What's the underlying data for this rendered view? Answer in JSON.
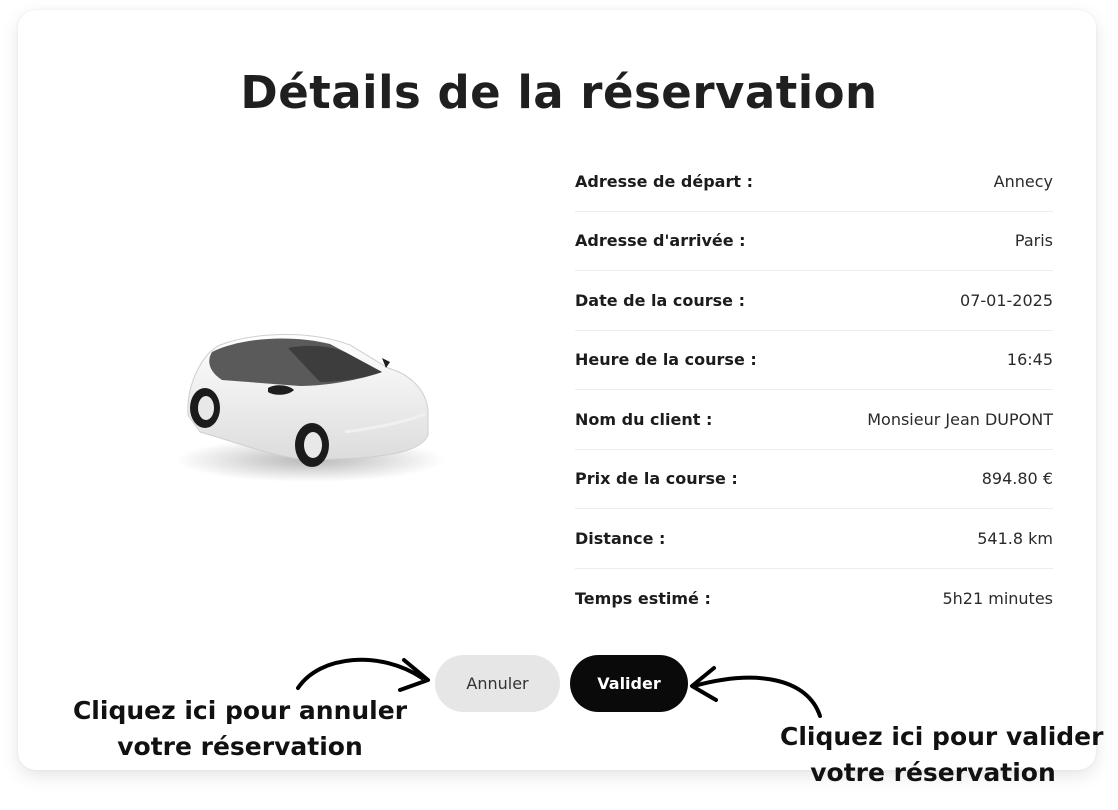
{
  "page": {
    "title": "Détails de la réservation"
  },
  "details": [
    {
      "label": "Adresse de départ :",
      "value": "Annecy"
    },
    {
      "label": "Adresse d'arrivée :",
      "value": "Paris"
    },
    {
      "label": "Date de la course :",
      "value": "07-01-2025"
    },
    {
      "label": "Heure de la course :",
      "value": "16:45"
    },
    {
      "label": "Nom du client :",
      "value": "Monsieur Jean DUPONT"
    },
    {
      "label": "Prix de la course :",
      "value": "894.80 €"
    },
    {
      "label": "Distance :",
      "value": "541.8 km"
    },
    {
      "label": "Temps estimé :",
      "value": "5h21 minutes"
    }
  ],
  "actions": {
    "cancel_label": "Annuler",
    "validate_label": "Valider"
  },
  "hints": {
    "cancel_line1": "Cliquez ici pour annuler",
    "cancel_line2": "votre réservation",
    "validate_line1": "Cliquez ici pour valider",
    "validate_line2": "votre réservation"
  },
  "icons": {
    "car": "car-illustration",
    "cancel_arrow": "arrow-right-icon",
    "validate_arrow": "arrow-left-icon"
  },
  "colors": {
    "cancel_bg": "#e6e6e6",
    "validate_bg": "#0a0a0a",
    "text": "#1c1c1c"
  }
}
